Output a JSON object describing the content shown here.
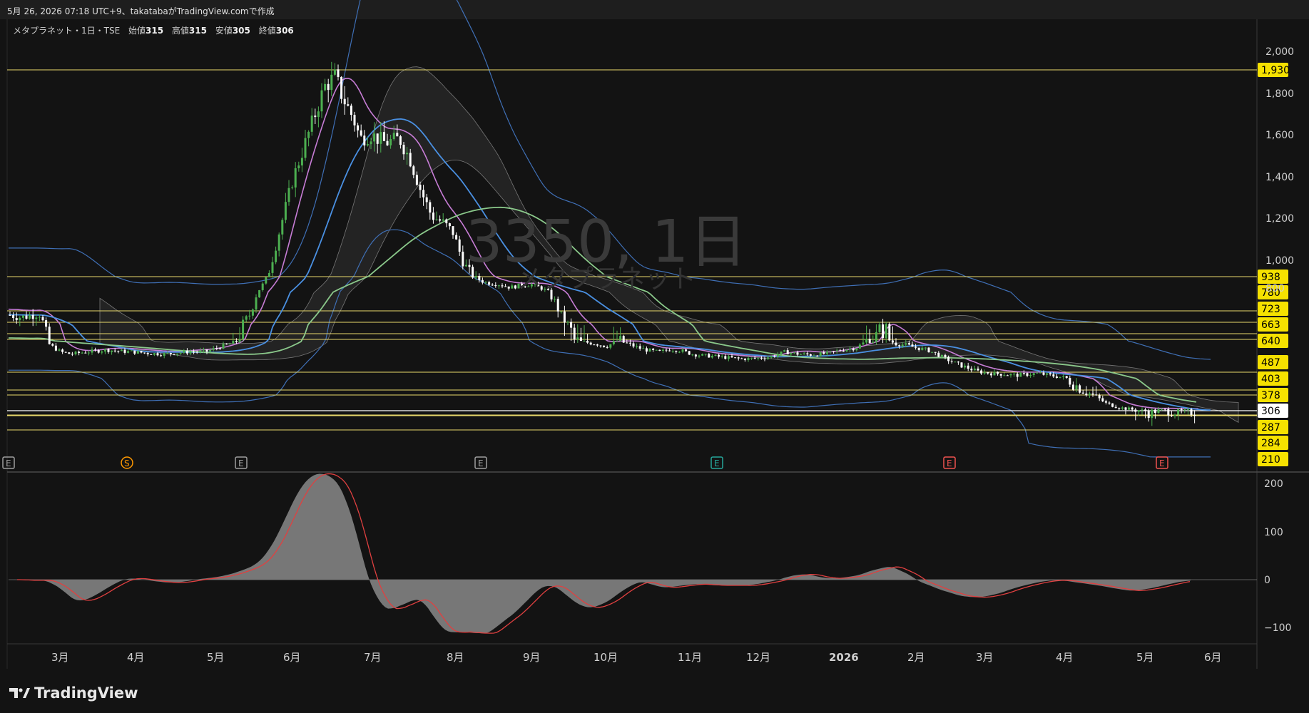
{
  "header": {
    "caption": "5月 26, 2026 07:18 UTC+9、takatabaがTradingView.comで作成"
  },
  "legend": {
    "symbol_info": "メタプラネット・1日・TSE",
    "open_label": "始値",
    "open_value": "315",
    "high_label": "高値",
    "high_value": "315",
    "low_label": "安値",
    "low_value": "305",
    "close_label": "終値",
    "close_value": "306"
  },
  "watermark": {
    "symbol": "3350, 1日",
    "name": "メタプラネット"
  },
  "colors": {
    "background": "#131313",
    "level_line": "#e8d96b",
    "price_badge": "#f5e100",
    "last_price_badge": "#ffffff",
    "candle_up": "#4caf50",
    "candle_down": "#ffffff",
    "ma_fast": "#c77dd6",
    "ma_mid": "#4a90e2",
    "ma_slow": "#8bc98b",
    "bollinger": "#3f6fb5",
    "macd_signal": "#e04040",
    "macd_hist": "#8a8a8a"
  },
  "price_axis": {
    "ticks": [
      "2,000",
      "1,800",
      "1,600",
      "1,400",
      "1,200",
      "1,000",
      "800"
    ]
  },
  "level_badges": [
    {
      "price": 1930,
      "label": "1,930",
      "kind": "level"
    },
    {
      "price": 938,
      "label": "938",
      "kind": "level"
    },
    {
      "price": 780,
      "label": "780",
      "kind": "level"
    },
    {
      "price": 723,
      "label": "723",
      "kind": "level"
    },
    {
      "price": 663,
      "label": "663",
      "kind": "level"
    },
    {
      "price": 640,
      "label": "640",
      "kind": "level"
    },
    {
      "price": 487,
      "label": "487",
      "kind": "level"
    },
    {
      "price": 403,
      "label": "403",
      "kind": "level"
    },
    {
      "price": 378,
      "label": "378",
      "kind": "level"
    },
    {
      "price": 306,
      "label": "306",
      "kind": "last"
    },
    {
      "price": 287,
      "label": "287",
      "kind": "level"
    },
    {
      "price": 284,
      "label": "284",
      "kind": "level"
    },
    {
      "price": 210,
      "label": "210",
      "kind": "level"
    }
  ],
  "event_markers": [
    {
      "label": "E",
      "kind": "earnings-gray"
    },
    {
      "label": "S",
      "kind": "split"
    },
    {
      "label": "E",
      "kind": "earnings-gray"
    },
    {
      "label": "E",
      "kind": "earnings-gray"
    },
    {
      "label": "E",
      "kind": "earnings-green"
    },
    {
      "label": "E",
      "kind": "earnings-red"
    },
    {
      "label": "E",
      "kind": "earnings-red"
    }
  ],
  "macd_axis": {
    "ticks": [
      "200",
      "100",
      "0",
      "−100"
    ]
  },
  "time_axis": {
    "labels": [
      "3月",
      "4月",
      "5月",
      "6月",
      "7月",
      "8月",
      "9月",
      "10月",
      "11月",
      "12月",
      "2026",
      "2月",
      "3月",
      "4月",
      "5月",
      "6月"
    ]
  },
  "footer": {
    "brand": "TradingView"
  }
}
